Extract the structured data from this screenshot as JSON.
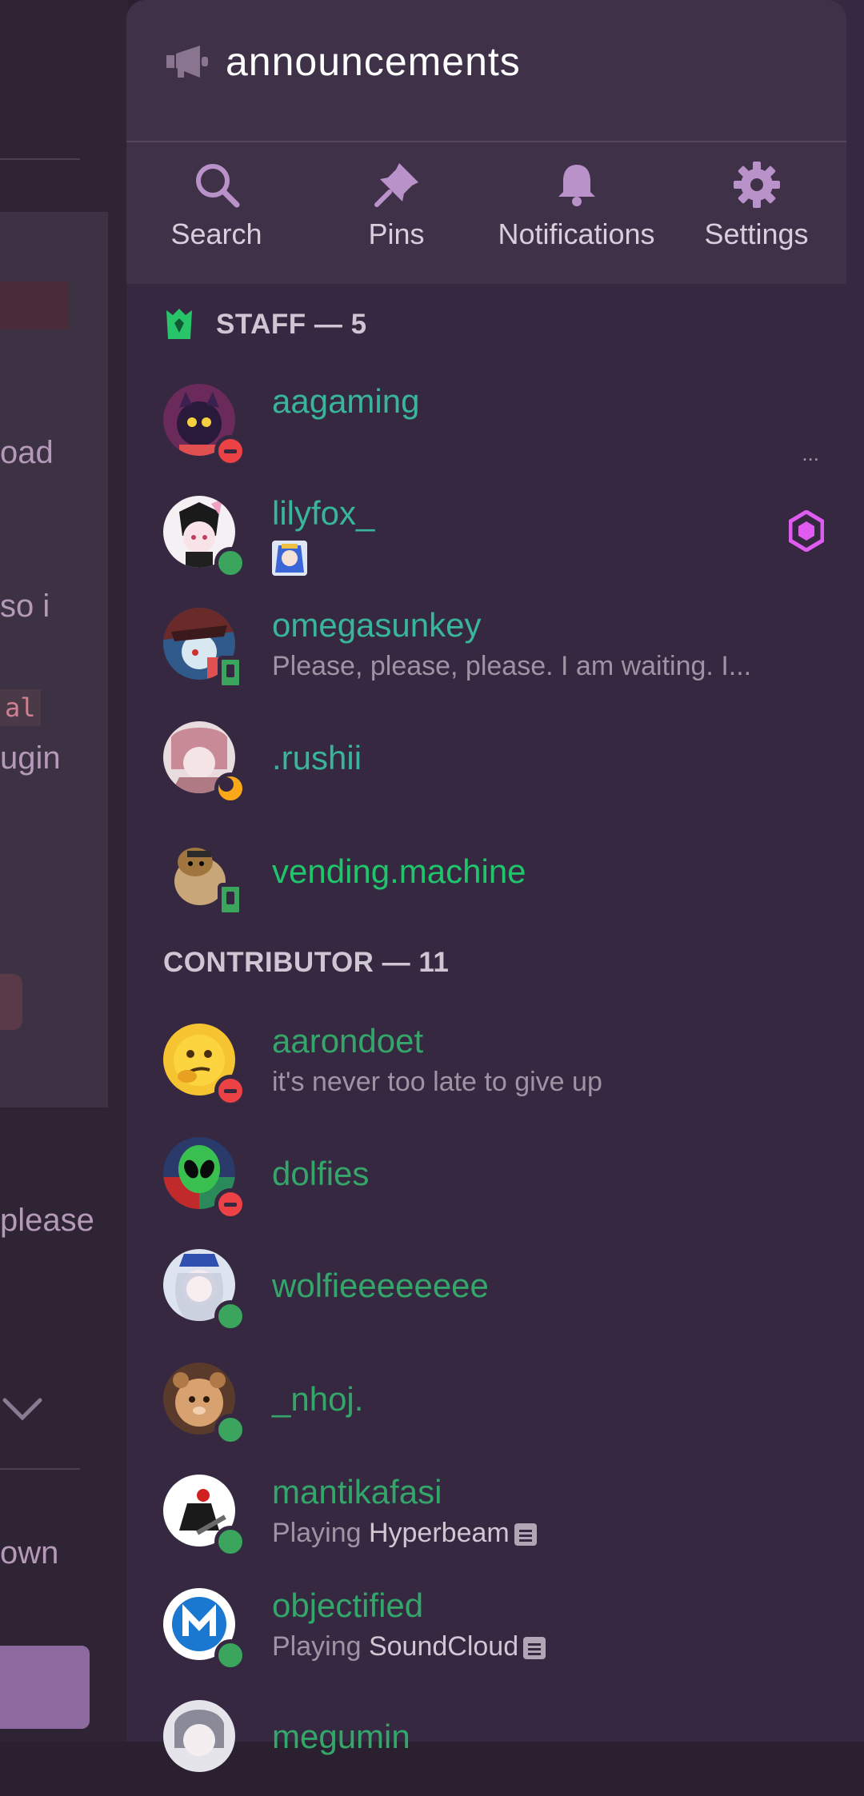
{
  "background": {
    "fragments": [
      {
        "text": "oad"
      },
      {
        "text": "so i"
      },
      {
        "text": "al"
      },
      {
        "text": "ugin"
      },
      {
        "text": "please"
      },
      {
        "text": "own"
      }
    ]
  },
  "header": {
    "channel_icon": "megaphone-icon",
    "channel_name": "announcements",
    "actions": [
      {
        "label": "Search",
        "icon": "search-icon"
      },
      {
        "label": "Pins",
        "icon": "pin-icon"
      },
      {
        "label": "Notifications",
        "icon": "bell-icon"
      },
      {
        "label": "Settings",
        "icon": "gear-icon"
      }
    ]
  },
  "sections": [
    {
      "title": "STAFF — 5",
      "members": [
        {
          "name": "aagaming",
          "status": "dnd",
          "subtext": "",
          "ellipsis": "..."
        },
        {
          "name": "lilyfox_",
          "status": "online",
          "subtext": "",
          "badge": "nitro-icon"
        },
        {
          "name": "omegasunkey",
          "status": "mobile",
          "subtext": "Please, please, please. I am waiting. I..."
        },
        {
          "name": ".rushii",
          "status": "idle",
          "subtext": ""
        },
        {
          "name": "vending.machine",
          "status": "mobile",
          "subtext": ""
        }
      ]
    },
    {
      "title": "CONTRIBUTOR — 11",
      "members": [
        {
          "name": "aarondoet",
          "status": "dnd",
          "subtext": "it's never too late to give up"
        },
        {
          "name": "dolfies",
          "status": "dnd",
          "subtext": ""
        },
        {
          "name": "wolfieeeeeeee",
          "status": "online",
          "subtext": ""
        },
        {
          "name": "_nhoj.",
          "status": "online",
          "subtext": ""
        },
        {
          "name": "mantikafasi",
          "status": "online",
          "activity_prefix": "Playing",
          "activity": "Hyperbeam"
        },
        {
          "name": "objectified",
          "status": "online",
          "activity_prefix": "Playing",
          "activity": "SoundCloud"
        },
        {
          "name": "megumin",
          "status": "online",
          "subtext": ""
        }
      ]
    }
  ],
  "colors": {
    "drawer_bg": "#352840",
    "header_bg": "#3f3148",
    "staff_name": "#39b59c",
    "contributor_name": "#34a66a",
    "online": "#3ba55d",
    "dnd": "#ed4245",
    "idle": "#faa81a"
  }
}
